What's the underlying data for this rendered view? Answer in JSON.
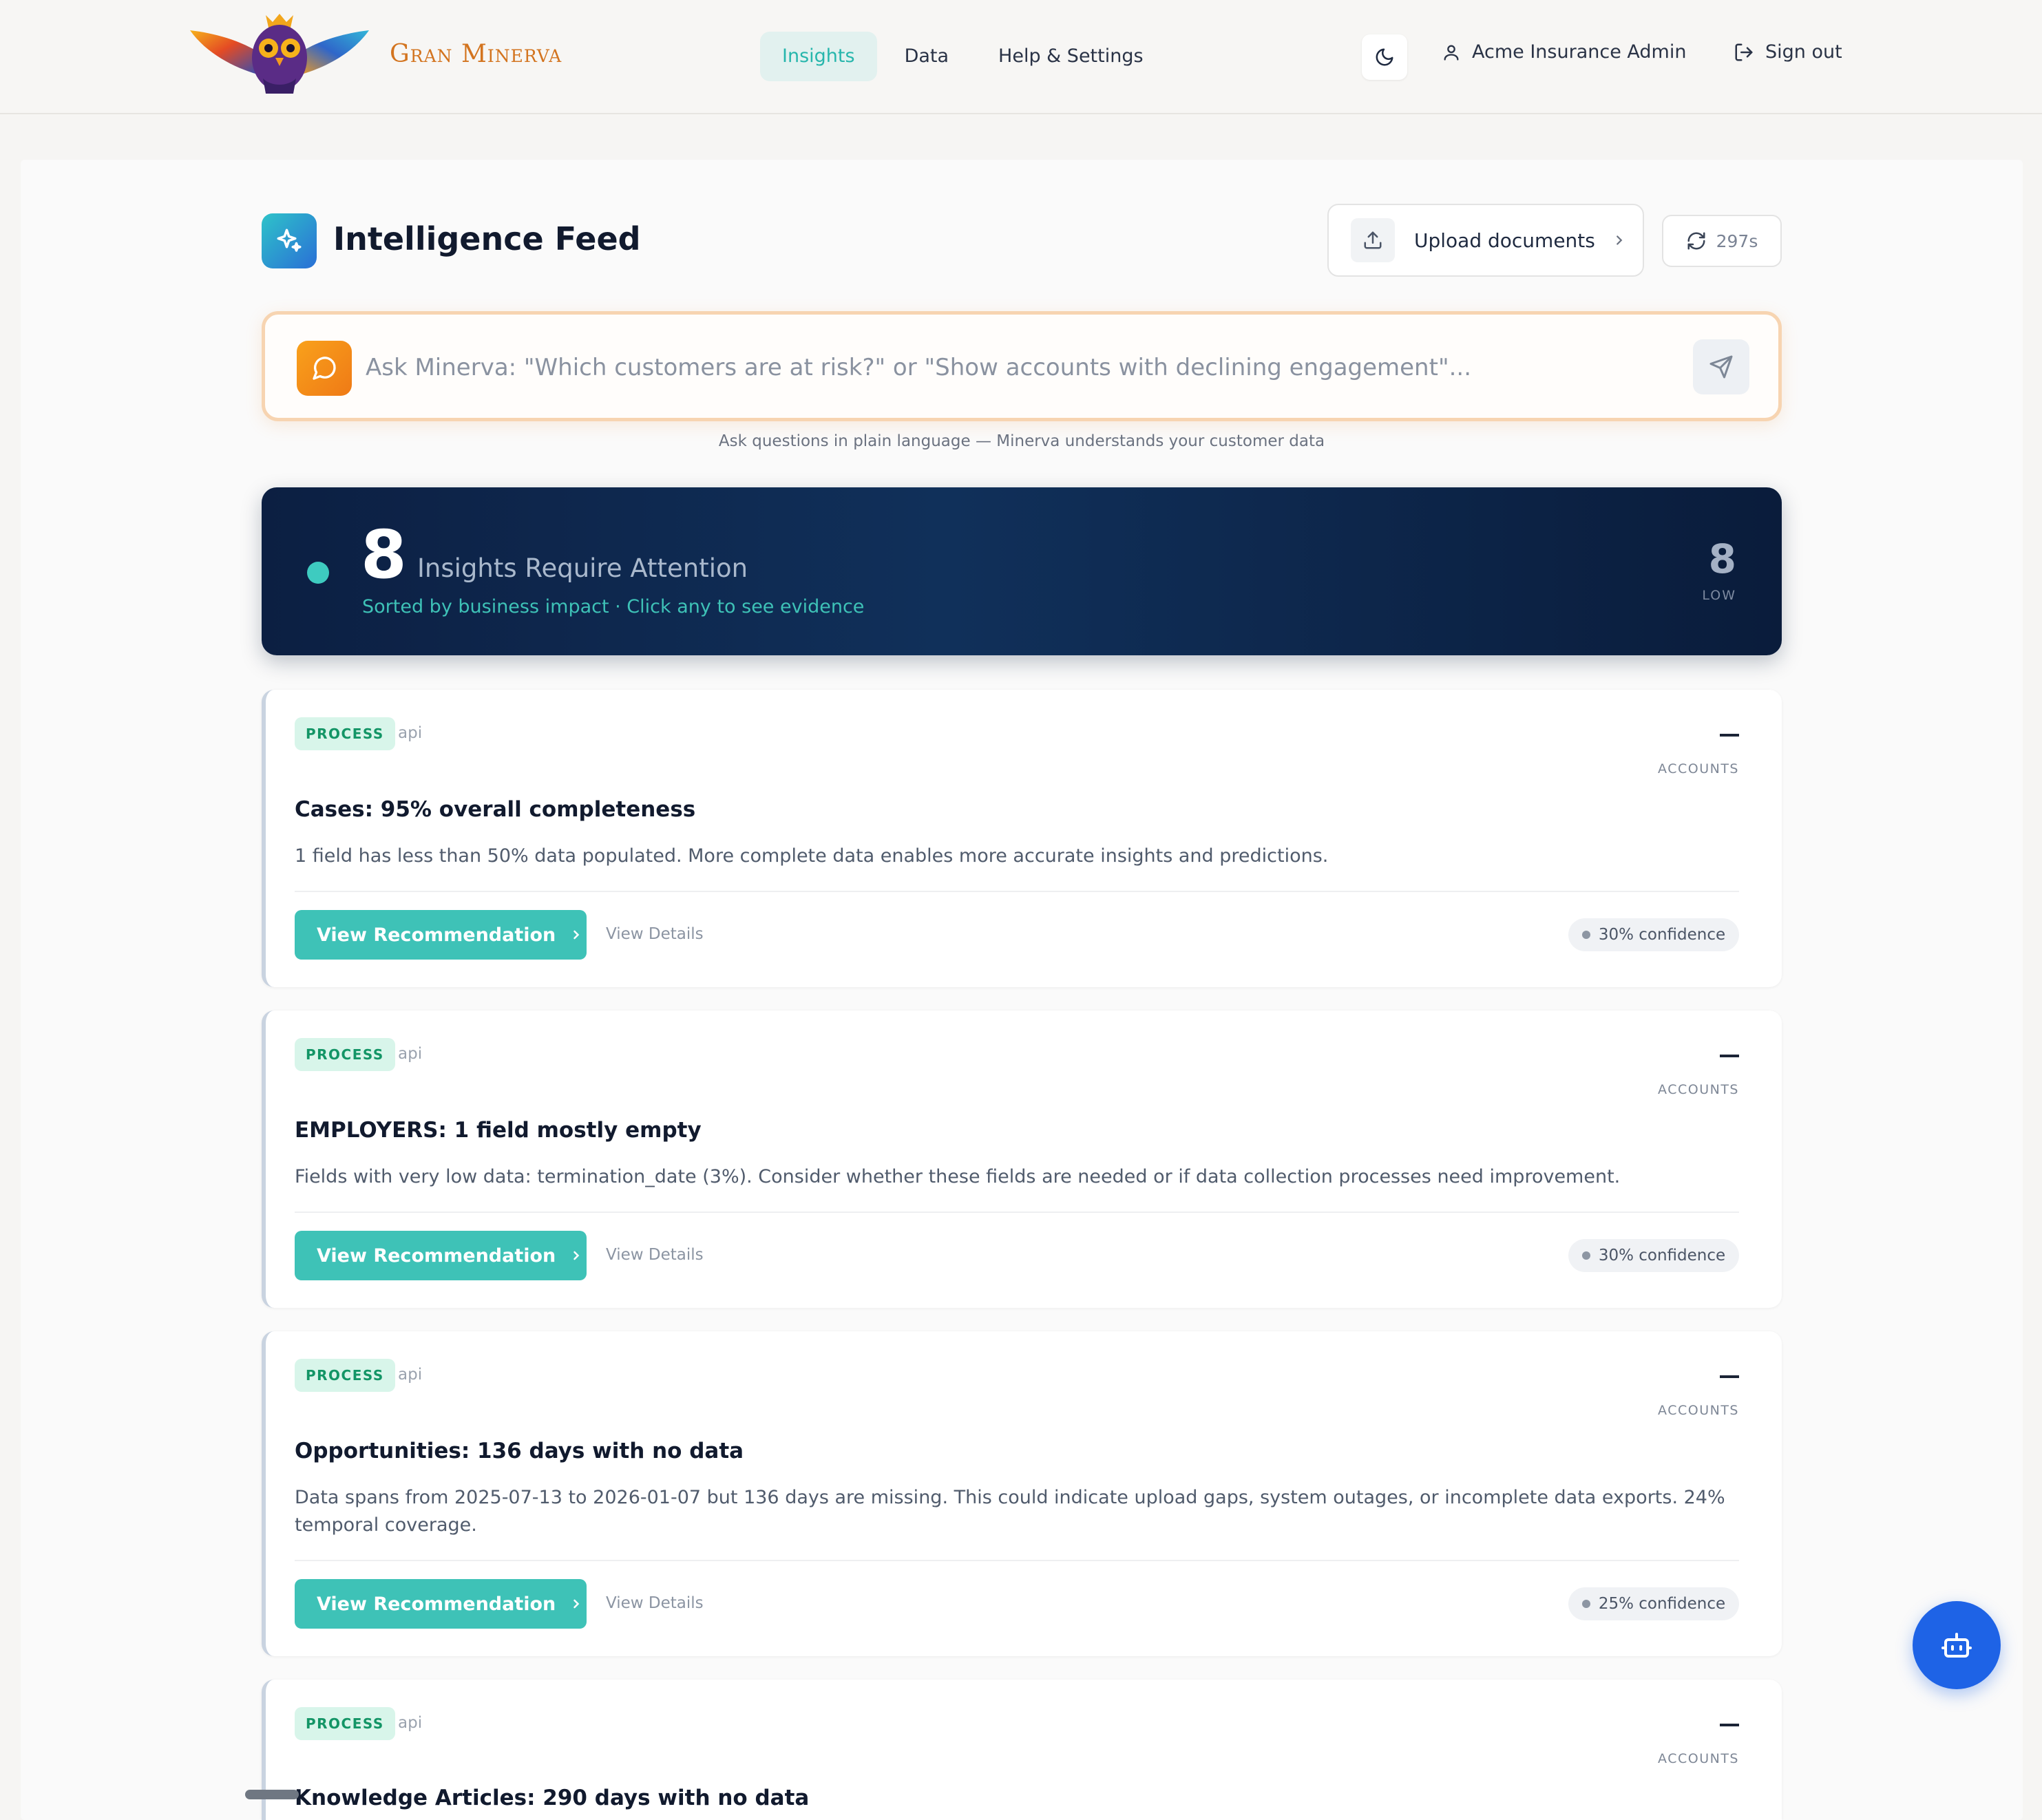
{
  "brand": {
    "name": "Gran Minerva"
  },
  "nav": {
    "items": [
      {
        "label": "Insights",
        "active": true
      },
      {
        "label": "Data",
        "active": false
      },
      {
        "label": "Help & Settings",
        "active": false
      }
    ],
    "theme_icon": "moon-icon",
    "user_label": "Acme Insurance Admin",
    "signout_label": "Sign out"
  },
  "feed": {
    "title": "Intelligence Feed",
    "upload_label": "Upload documents",
    "refresh_label": "297s"
  },
  "ask": {
    "placeholder": "Ask Minerva: \"Which customers are at risk?\" or \"Show accounts with declining engagement\"...",
    "hint": "Ask questions in plain language — Minerva understands your customer data"
  },
  "hero": {
    "count": "8",
    "label": "Insights Require Attention",
    "subtitle": "Sorted by business impact · Click any to see evidence",
    "side_count": "8",
    "side_label": "LOW"
  },
  "cards": [
    {
      "tag": "PROCESS",
      "source": "api",
      "accounts_label": "ACCOUNTS",
      "title": "Cases: 95% overall completeness",
      "description": "1 field has less than 50% data populated. More complete data enables more accurate insights and predictions.",
      "rec_label": "View Recommendation",
      "details_label": "View Details",
      "confidence": "30% confidence"
    },
    {
      "tag": "PROCESS",
      "source": "api",
      "accounts_label": "ACCOUNTS",
      "title": "EMPLOYERS: 1 field mostly empty",
      "description": "Fields with very low data: termination_date (3%). Consider whether these fields are needed or if data collection processes need improvement.",
      "rec_label": "View Recommendation",
      "details_label": "View Details",
      "confidence": "30% confidence"
    },
    {
      "tag": "PROCESS",
      "source": "api",
      "accounts_label": "ACCOUNTS",
      "title": "Opportunities: 136 days with no data",
      "description": "Data spans from 2025-07-13 to 2026-01-07 but 136 days are missing. This could indicate upload gaps, system outages, or incomplete data exports. 24% temporal coverage.",
      "rec_label": "View Recommendation",
      "details_label": "View Details",
      "confidence": "25% confidence"
    },
    {
      "tag": "PROCESS",
      "source": "api",
      "accounts_label": "ACCOUNTS",
      "title": "Knowledge Articles: 290 days with no data"
    }
  ],
  "colors": {
    "accent_teal": "#3ec2b7",
    "brand_orange": "#d3741f",
    "hero_navy": "#0c1f42",
    "fab_blue": "#1e63e6"
  }
}
